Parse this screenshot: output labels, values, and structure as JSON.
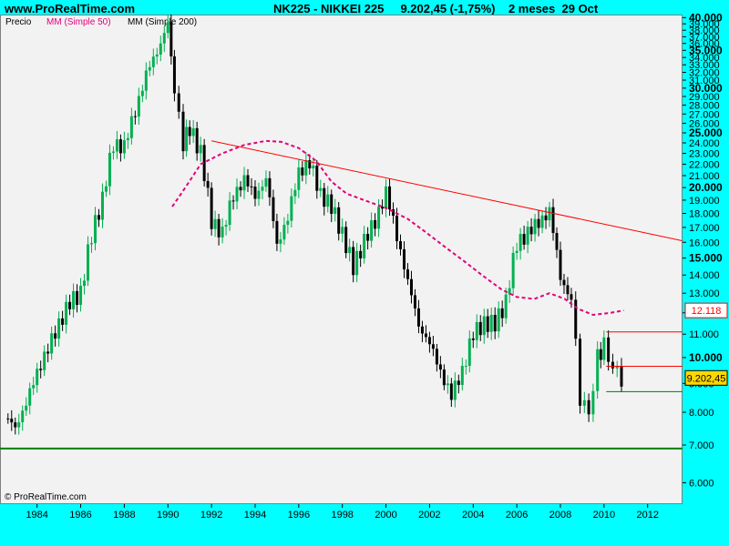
{
  "header": {
    "site": "www.ProRealTime.com",
    "title": "NK225 - NIKKEI 225     9.202,45 (-1,75%)    2 meses  29 Oct"
  },
  "legend": {
    "price": "Precio",
    "ma50": "MM (Simple 50)",
    "ma200": "MM (Simple 200)"
  },
  "copyright": "© ProRealTime.com",
  "colors": {
    "background": "#00ffff",
    "plot_bg": "#f2f2f2",
    "up_candle": "#00b050",
    "down_candle": "#000000",
    "ma50": "#e0007a",
    "trendline_red": "#ff0000",
    "support_green": "#008000"
  },
  "chart_data": {
    "type": "candlestick",
    "period": "2 meses",
    "x_ticks": [
      "1984",
      "1986",
      "1988",
      "1990",
      "1992",
      "1994",
      "1996",
      "1998",
      "2000",
      "2002",
      "2004",
      "2006",
      "2008",
      "2010",
      "2012"
    ],
    "y_ticks": [
      "6.000",
      "7.000",
      "8.000",
      "9.000",
      "10.000",
      "11.000",
      "12.000",
      "13.000",
      "14.000",
      "15.000",
      "16.000",
      "17.000",
      "18.000",
      "19.000",
      "20.000",
      "21.000",
      "22.000",
      "23.000",
      "24.000",
      "25.000",
      "26.000",
      "27.000",
      "28.000",
      "29.000",
      "30.000",
      "31.000",
      "32.000",
      "33.000",
      "34.000",
      "35.000",
      "36.000",
      "37.000",
      "38.000",
      "39.000",
      "40.000"
    ],
    "y_bold_ticks": [
      "10.000",
      "15.000",
      "20.000",
      "25.000",
      "30.000",
      "35.000",
      "40.000"
    ],
    "ylim": [
      5500,
      40500
    ],
    "xlim": [
      1982.3,
      2013.6
    ],
    "y_scale": "log",
    "price_series": [
      [
        1982.5,
        7800
      ],
      [
        1983.0,
        7600
      ],
      [
        1983.5,
        8200
      ],
      [
        1984.0,
        9500
      ],
      [
        1984.5,
        10300
      ],
      [
        1985.0,
        11500
      ],
      [
        1985.5,
        12500
      ],
      [
        1986.0,
        13000
      ],
      [
        1986.5,
        16500
      ],
      [
        1987.0,
        19000
      ],
      [
        1987.5,
        24000
      ],
      [
        1988.0,
        23500
      ],
      [
        1988.5,
        27500
      ],
      [
        1989.0,
        31500
      ],
      [
        1989.5,
        35000
      ],
      [
        1990.0,
        38900
      ],
      [
        1990.3,
        29000
      ],
      [
        1990.7,
        24000
      ],
      [
        1991.0,
        25500
      ],
      [
        1991.5,
        23000
      ],
      [
        1992.0,
        17500
      ],
      [
        1992.5,
        16500
      ],
      [
        1993.0,
        19500
      ],
      [
        1993.5,
        20500
      ],
      [
        1994.0,
        19500
      ],
      [
        1994.5,
        20500
      ],
      [
        1995.0,
        16000
      ],
      [
        1995.5,
        17500
      ],
      [
        1996.0,
        21500
      ],
      [
        1996.5,
        22000
      ],
      [
        1997.0,
        19500
      ],
      [
        1997.5,
        18500
      ],
      [
        1998.0,
        16500
      ],
      [
        1998.5,
        14500
      ],
      [
        1999.0,
        16000
      ],
      [
        1999.5,
        17500
      ],
      [
        2000.0,
        19500
      ],
      [
        2000.5,
        16500
      ],
      [
        2001.0,
        13500
      ],
      [
        2001.5,
        11500
      ],
      [
        2002.0,
        10500
      ],
      [
        2002.5,
        9500
      ],
      [
        2003.0,
        8500
      ],
      [
        2003.5,
        9500
      ],
      [
        2004.0,
        11000
      ],
      [
        2004.5,
        11500
      ],
      [
        2005.0,
        11500
      ],
      [
        2005.5,
        12500
      ],
      [
        2006.0,
        16000
      ],
      [
        2006.5,
        16500
      ],
      [
        2007.0,
        17500
      ],
      [
        2007.5,
        18000
      ],
      [
        2008.0,
        14000
      ],
      [
        2008.5,
        12500
      ],
      [
        2008.9,
        8500
      ],
      [
        2009.3,
        8000
      ],
      [
        2009.7,
        10000
      ],
      [
        2010.0,
        10500
      ],
      [
        2010.4,
        9500
      ],
      [
        2010.8,
        9202.45
      ]
    ],
    "ma50_series": [
      [
        1990.2,
        18500
      ],
      [
        1990.8,
        20000
      ],
      [
        1991.5,
        22000
      ],
      [
        1992.5,
        23000
      ],
      [
        1993.5,
        23800
      ],
      [
        1994.5,
        24200
      ],
      [
        1995.2,
        24100
      ],
      [
        1996.0,
        23500
      ],
      [
        1996.8,
        22300
      ],
      [
        1997.5,
        20500
      ],
      [
        1998.2,
        19500
      ],
      [
        1999.0,
        19000
      ],
      [
        2000.0,
        18400
      ],
      [
        2001.0,
        17600
      ],
      [
        2001.8,
        16700
      ],
      [
        2002.8,
        15600
      ],
      [
        2003.6,
        14800
      ],
      [
        2004.4,
        14000
      ],
      [
        2005.3,
        13200
      ],
      [
        2006.0,
        12800
      ],
      [
        2006.8,
        12700
      ],
      [
        2007.5,
        13000
      ],
      [
        2008.2,
        12700
      ],
      [
        2008.8,
        12200
      ],
      [
        2009.5,
        11900
      ],
      [
        2010.3,
        12000
      ],
      [
        2010.9,
        12118
      ]
    ],
    "trendline": [
      [
        1992.0,
        24200
      ],
      [
        2013.6,
        16100
      ]
    ],
    "support_lines": [
      {
        "y": 6900,
        "color": "#008000",
        "x_start": 1982.3
      },
      {
        "y": 8700,
        "color": "#008000",
        "x_start": 2010.1
      },
      {
        "y": 9650,
        "color": "#ff0000",
        "x_start": 2010.1
      },
      {
        "y": 11100,
        "color": "#ff0000",
        "x_start": 2010.1
      }
    ],
    "value_labels": [
      {
        "text": "12.118",
        "value": 12118,
        "style": "outlined"
      },
      {
        "text": "9.202,45",
        "value": 9202.45,
        "style": "filled"
      }
    ],
    "grid": false,
    "legend_placement": "top-left"
  }
}
